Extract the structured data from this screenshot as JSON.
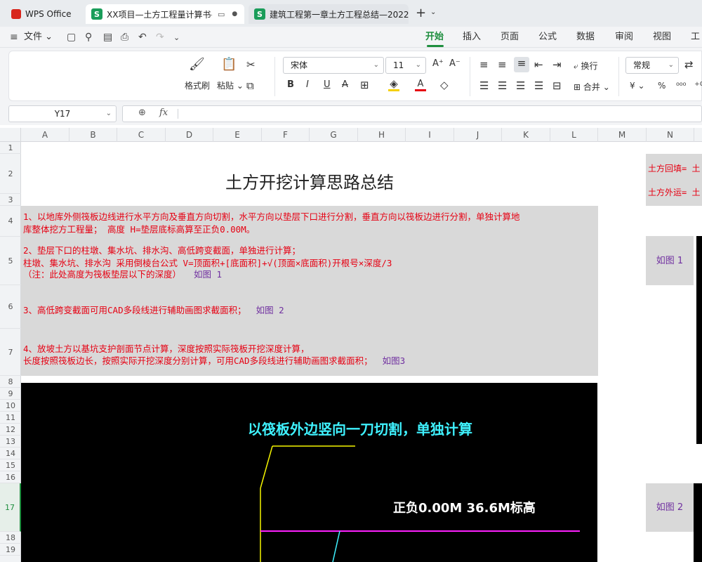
{
  "tabs": {
    "home": "WPS Office",
    "doc1": "XX项目—土方工程量计算书—",
    "doc2": "建筑工程第一章土方工程总结—2022"
  },
  "menu": {
    "file": "文件",
    "tabs": [
      "开始",
      "插入",
      "页面",
      "公式",
      "数据",
      "审阅",
      "视图",
      "工具"
    ]
  },
  "ribbon": {
    "format_painter": "格式刷",
    "paste": "粘贴",
    "font": "宋体",
    "size": "11",
    "wrap": "换行",
    "merge": "合并",
    "number_format": "常规",
    "currency": "¥",
    "percent": "%"
  },
  "formula": {
    "name_box": "Y17",
    "fx": "fx"
  },
  "columns": [
    "A",
    "B",
    "C",
    "D",
    "E",
    "F",
    "G",
    "H",
    "I",
    "J",
    "K",
    "L",
    "M",
    "N"
  ],
  "rows": [
    "1",
    "2",
    "3",
    "4",
    "5",
    "6",
    "7",
    "8",
    "9",
    "10",
    "11",
    "12",
    "13",
    "14",
    "15",
    "16",
    "17",
    "18",
    "19"
  ],
  "sheet": {
    "title": "土方开挖计算思路总结",
    "p1": "1、以地库外侧筏板边线进行水平方向及垂直方向切割，水平方向以垫层下口进行分割，垂直方向以筏板边进行分割，单独计算地",
    "p1b": "库整体挖方工程量； 高度 H=垫层底标高算至正负0.00M。",
    "p2": "2、垫层下口的柱墩、集水坑、排水沟、高低跨变截面，单独进行计算；",
    "p2b": "柱墩、集水坑、排水沟 采用倒棱台公式  V=顶面积+[底面积]+√(顶面×底面积)开根号×深度/3",
    "p2c": "（注：此处高度为筏板垫层以下的深度）",
    "p2c_ref": "如图 1",
    "p3": "3、高低跨变截面可用CAD多段线进行辅助画图求截面积；",
    "p3_ref": "如图 2",
    "p4": "4、放坡土方以基坑支护剖面节点计算，深度按照实际筏板开挖深度计算，",
    "p4b": "长度按照筏板边长，按照实际开挖深度分别计算，可用CAD多段线进行辅助画图求截面积；",
    "p4b_ref": "如图3",
    "side1": "土方回填= 土",
    "side2": "土方外运= 土",
    "fig1": "如图 1",
    "fig2": "如图 2"
  },
  "cad": {
    "title": "以筏板外边竖向一刀切割，单独计算",
    "level": "正负0.00M 36.6M标高"
  }
}
